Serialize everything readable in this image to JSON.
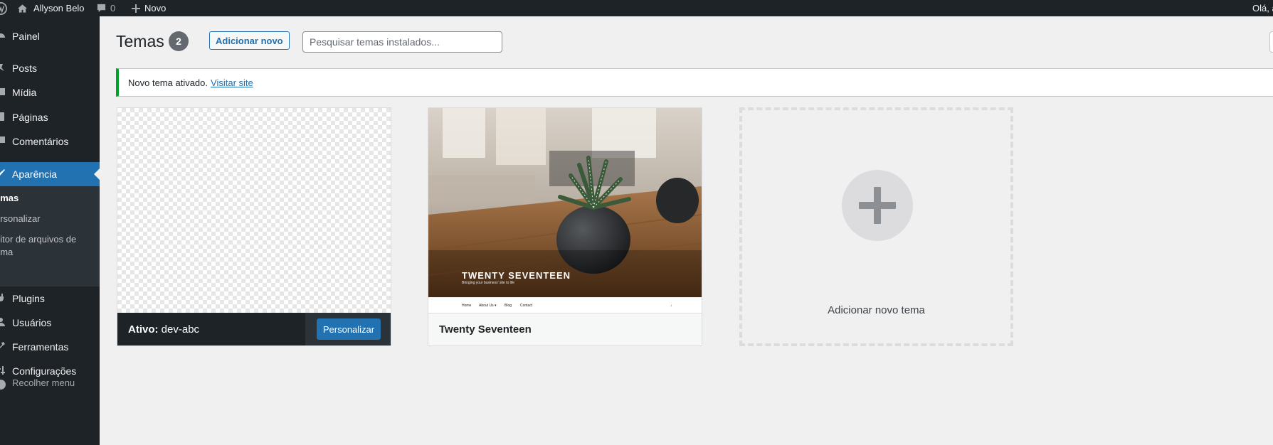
{
  "admin_bar": {
    "site_name": "Allyson Belo",
    "comments_count": "0",
    "new_label": "Novo",
    "howdy": "Olá, a"
  },
  "sidebar": {
    "items": [
      {
        "label": "Painel",
        "icon": "dashboard-icon"
      },
      {
        "label": "Posts",
        "icon": "pin-icon"
      },
      {
        "label": "Mídia",
        "icon": "media-icon"
      },
      {
        "label": "Páginas",
        "icon": "page-icon"
      },
      {
        "label": "Comentários",
        "icon": "comment-icon"
      },
      {
        "label": "Aparência",
        "icon": "brush-icon"
      },
      {
        "label": "Plugins",
        "icon": "plugin-icon"
      },
      {
        "label": "Usuários",
        "icon": "users-icon"
      },
      {
        "label": "Ferramentas",
        "icon": "tools-icon"
      },
      {
        "label": "Configurações",
        "icon": "settings-icon"
      }
    ],
    "submenu": [
      {
        "label": "emas"
      },
      {
        "label": "ersonalizar"
      },
      {
        "label": "ditor de arquivos de ema"
      }
    ],
    "collapse_label": "Recolher menu"
  },
  "header": {
    "title": "Temas",
    "count": "2",
    "add_new_label": "Adicionar novo",
    "search_placeholder": "Pesquisar temas instalados..."
  },
  "notice": {
    "text": "Novo tema ativado.",
    "link": "Visitar site"
  },
  "themes": [
    {
      "active_prefix": "Ativo:",
      "name": "dev-abc",
      "customize_label": "Personalizar"
    },
    {
      "name": "Twenty Seventeen",
      "preview_title": "TWENTY SEVENTEEN",
      "preview_tagline": "Bringing your business' site to life",
      "preview_nav": [
        "Home",
        "About Us ▾",
        "Blog",
        "Contact"
      ]
    }
  ],
  "add_theme": {
    "label": "Adicionar novo tema"
  },
  "colors": {
    "accent": "#2271b1",
    "admin_dark": "#1d2327",
    "success": "#00a32a"
  }
}
